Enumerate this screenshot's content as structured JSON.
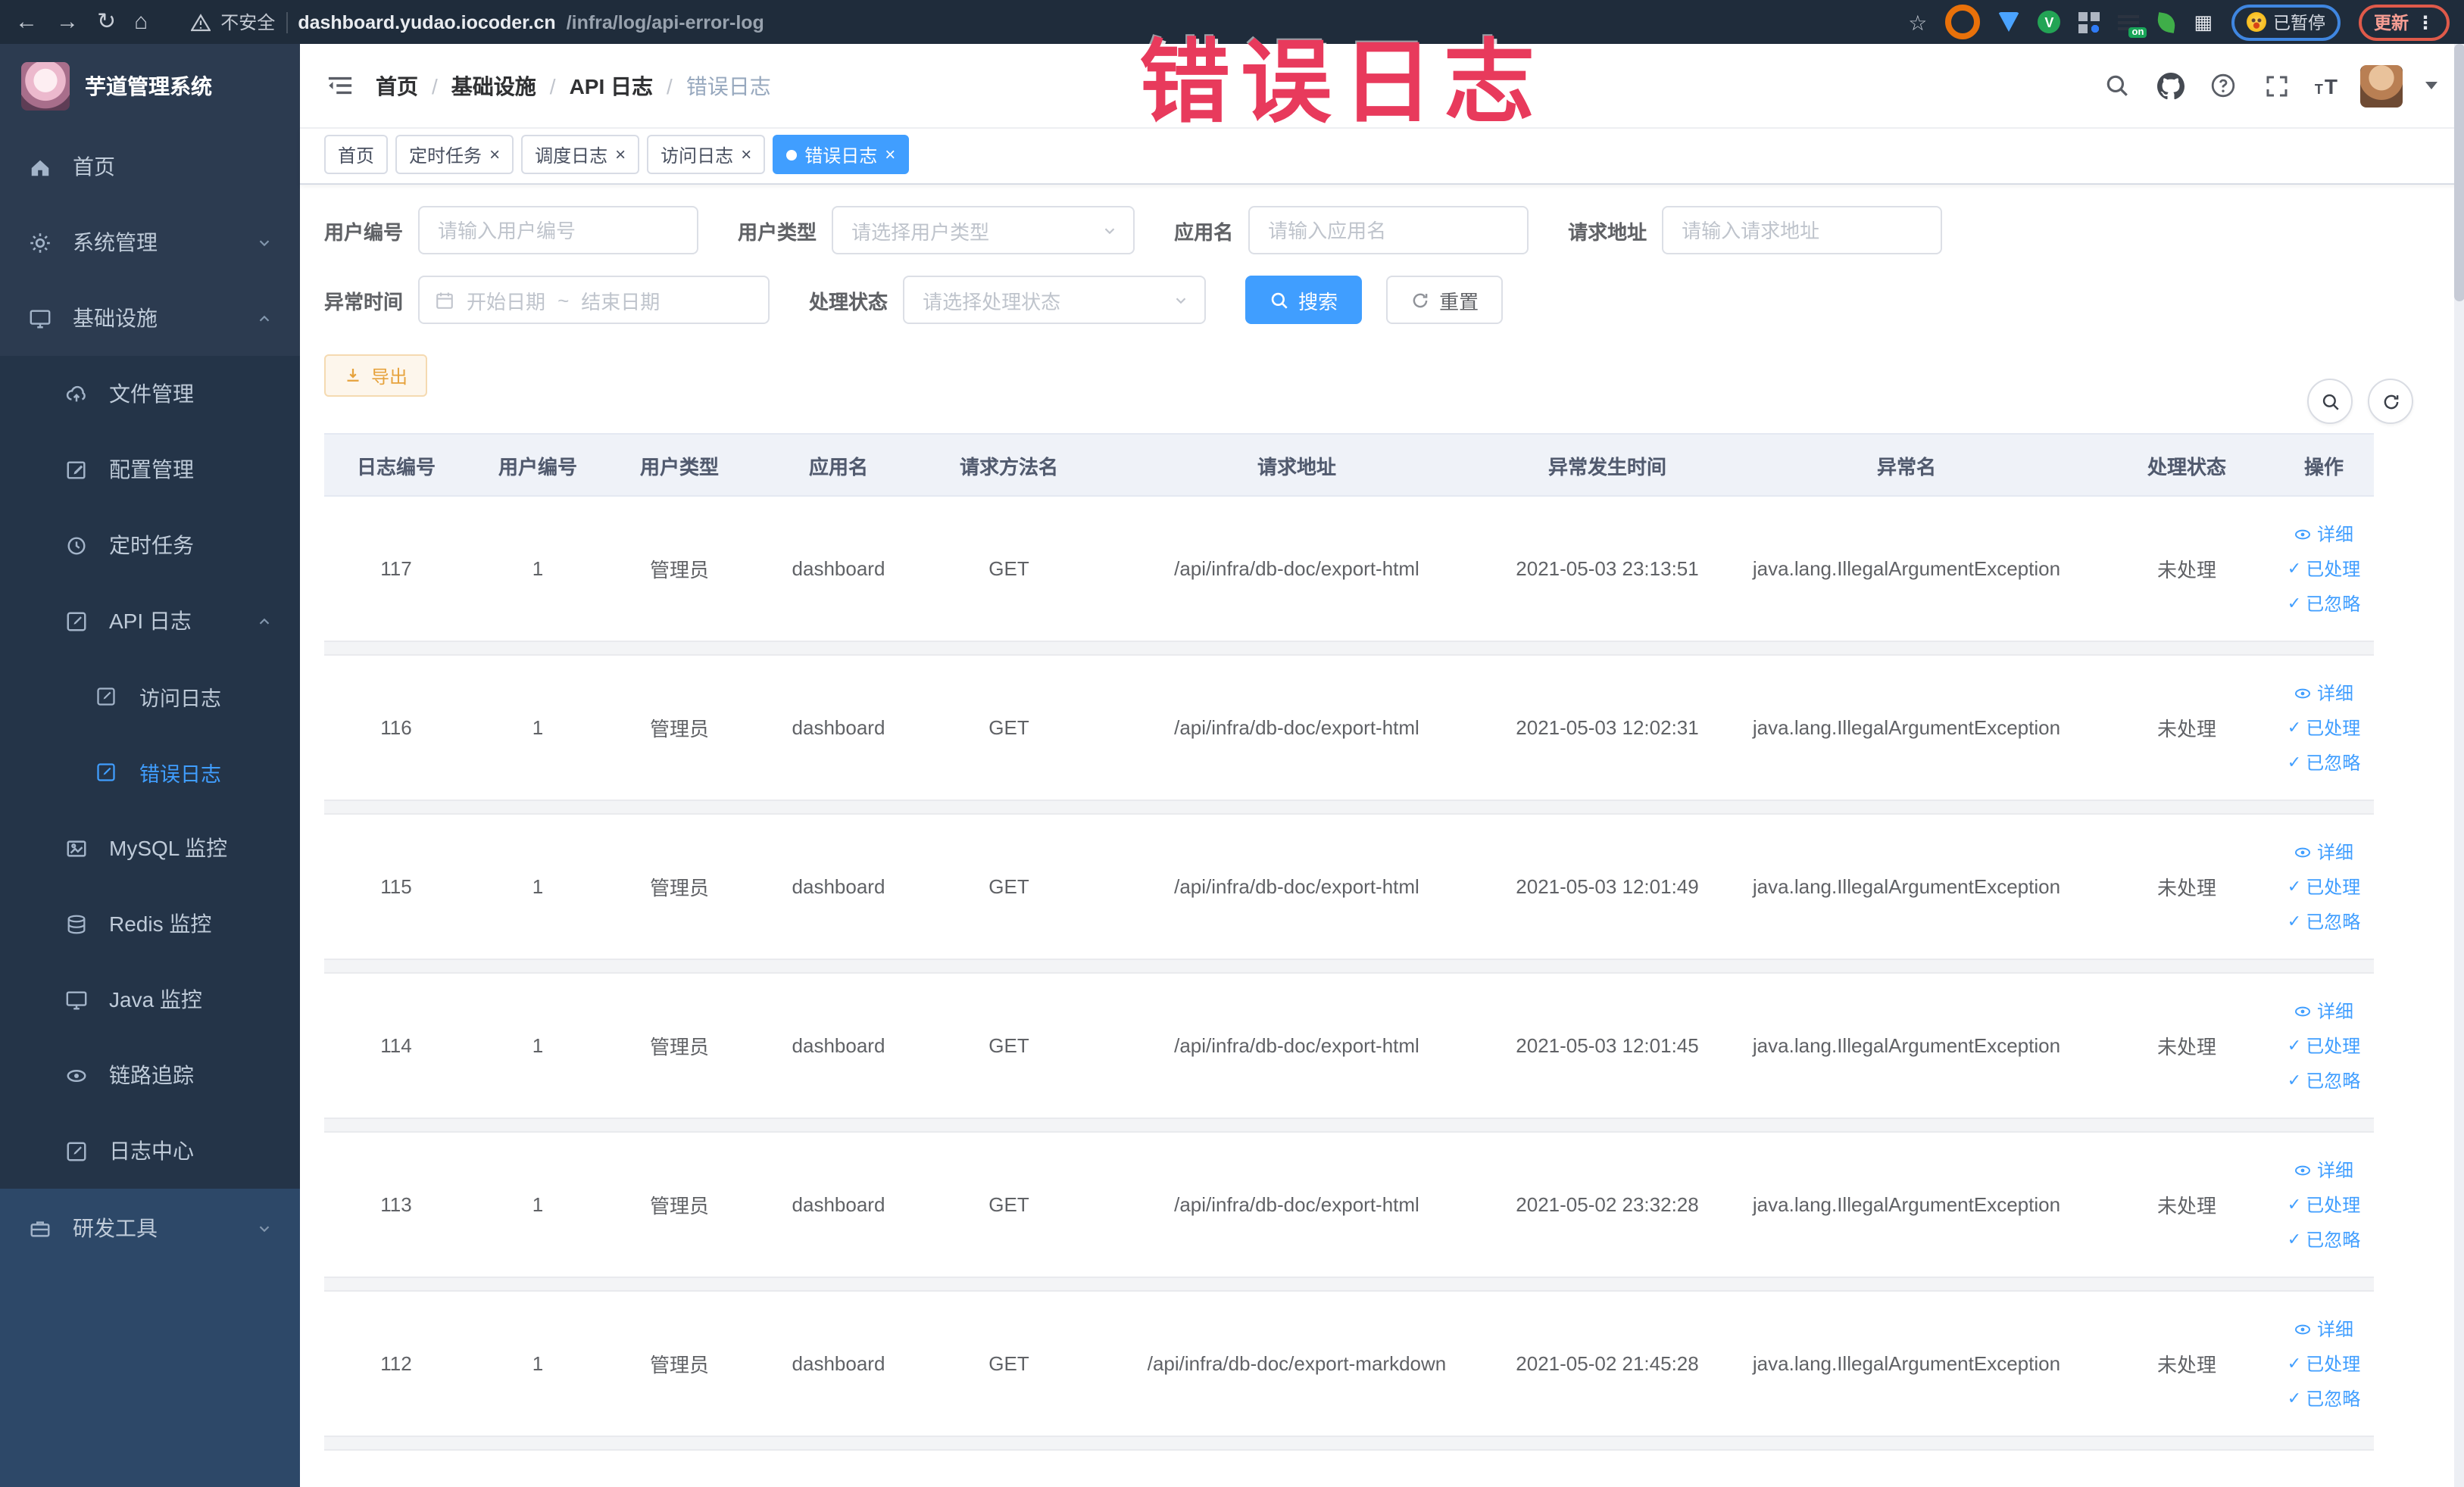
{
  "browser": {
    "security_label": "不安全",
    "url_domain": "dashboard.yudao.iocoder.cn",
    "url_path": "/infra/log/api-error-log",
    "paused_badge": "已暂停",
    "update_button": "更新"
  },
  "annotation": {
    "text": "错误日志",
    "color": "#e83a5c"
  },
  "sidebar": {
    "title": "芋道管理系统",
    "items": {
      "home": "首页",
      "system": "系统管理",
      "infra": "基础设施",
      "file": "文件管理",
      "config": "配置管理",
      "job": "定时任务",
      "apilog": "API 日志",
      "access": "访问日志",
      "error": "错误日志",
      "mysql": "MySQL 监控",
      "redis": "Redis 监控",
      "java": "Java 监控",
      "trace": "链路追踪",
      "logcenter": "日志中心",
      "devtools": "研发工具"
    }
  },
  "header": {
    "breadcrumb": [
      "首页",
      "基础设施",
      "API 日志",
      "错误日志"
    ]
  },
  "tabs": [
    {
      "label": "首页"
    },
    {
      "label": "定时任务"
    },
    {
      "label": "调度日志"
    },
    {
      "label": "访问日志"
    },
    {
      "label": "错误日志"
    }
  ],
  "filters": {
    "user_id_label": "用户编号",
    "user_id_placeholder": "请输入用户编号",
    "user_type_label": "用户类型",
    "user_type_placeholder": "请选择用户类型",
    "app_name_label": "应用名",
    "app_name_placeholder": "请输入应用名",
    "request_url_label": "请求地址",
    "request_url_placeholder": "请输入请求地址",
    "exception_time_label": "异常时间",
    "date_start_placeholder": "开始日期",
    "date_separator": "~",
    "date_end_placeholder": "结束日期",
    "process_status_label": "处理状态",
    "process_status_placeholder": "请选择处理状态",
    "search_button": "搜索",
    "reset_button": "重置"
  },
  "toolbar": {
    "export_button": "导出"
  },
  "table": {
    "columns": [
      "日志编号",
      "用户编号",
      "用户类型",
      "应用名",
      "请求方法名",
      "请求地址",
      "异常发生时间",
      "异常名",
      "处理状态",
      "操作"
    ],
    "actions": {
      "detail": "详细",
      "processed": "已处理",
      "ignored": "已忽略"
    },
    "rows": [
      {
        "id": "117",
        "user_id": "1",
        "user_type": "管理员",
        "app": "dashboard",
        "method": "GET",
        "url": "/api/infra/db-doc/export-html",
        "time": "2021-05-03 23:13:51",
        "exception": "java.lang.IllegalArgumentException",
        "status": "未处理"
      },
      {
        "id": "116",
        "user_id": "1",
        "user_type": "管理员",
        "app": "dashboard",
        "method": "GET",
        "url": "/api/infra/db-doc/export-html",
        "time": "2021-05-03 12:02:31",
        "exception": "java.lang.IllegalArgumentException",
        "status": "未处理"
      },
      {
        "id": "115",
        "user_id": "1",
        "user_type": "管理员",
        "app": "dashboard",
        "method": "GET",
        "url": "/api/infra/db-doc/export-html",
        "time": "2021-05-03 12:01:49",
        "exception": "java.lang.IllegalArgumentException",
        "status": "未处理"
      },
      {
        "id": "114",
        "user_id": "1",
        "user_type": "管理员",
        "app": "dashboard",
        "method": "GET",
        "url": "/api/infra/db-doc/export-html",
        "time": "2021-05-03 12:01:45",
        "exception": "java.lang.IllegalArgumentException",
        "status": "未处理"
      },
      {
        "id": "113",
        "user_id": "1",
        "user_type": "管理员",
        "app": "dashboard",
        "method": "GET",
        "url": "/api/infra/db-doc/export-html",
        "time": "2021-05-02 23:32:28",
        "exception": "java.lang.IllegalArgumentException",
        "status": "未处理"
      },
      {
        "id": "112",
        "user_id": "1",
        "user_type": "管理员",
        "app": "dashboard",
        "method": "GET",
        "url": "/api/infra/db-doc/export-markdown",
        "time": "2021-05-02 21:45:28",
        "exception": "java.lang.IllegalArgumentException",
        "status": "未处理"
      }
    ]
  },
  "colors": {
    "accent": "#409eff",
    "warning": "#e6a23c",
    "annotation_red": "#e83a5c",
    "sidebar_bg": "#2c3b50"
  }
}
